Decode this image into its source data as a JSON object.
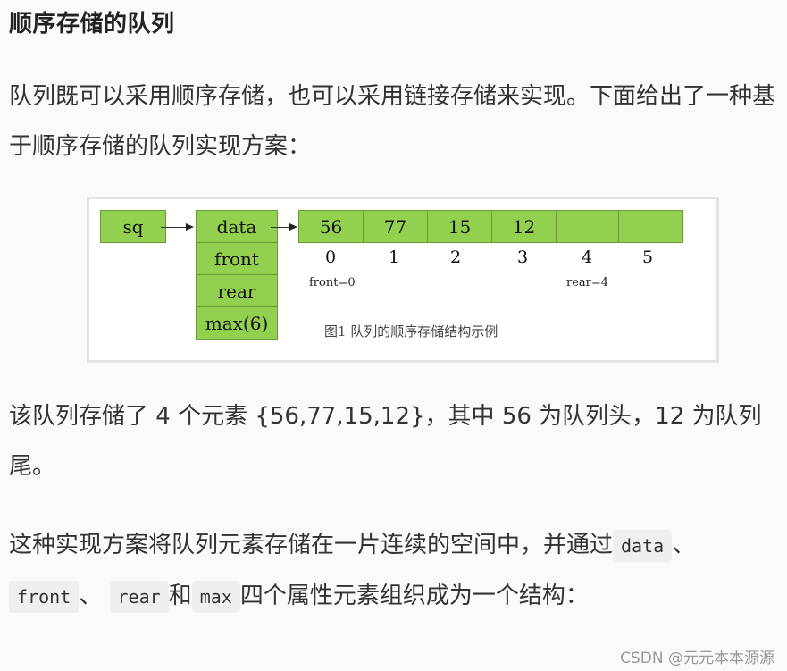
{
  "heading": "顺序存储的队列",
  "paragraph1": "队列既可以采用顺序存储，也可以采用链接存储来实现。下面给出了一种基于顺序存储的队列实现方案：",
  "figure": {
    "pointer_label": "sq",
    "struct_fields": [
      "data",
      "front",
      "rear",
      "max(6)"
    ],
    "array_values": [
      "56",
      "77",
      "15",
      "12",
      "",
      ""
    ],
    "indices": [
      "0",
      "1",
      "2",
      "3",
      "4",
      "5"
    ],
    "front_label": "front=0",
    "rear_label": "rear=4",
    "caption": "图1  队列的顺序存储结构示例",
    "box_color": "#92d050"
  },
  "paragraph2": "该队列存储了 4 个元素 {56,77,15,12}，其中 56 为队列头，12 为队列尾。",
  "paragraph3": {
    "part1": "这种实现方案将队列元素存储在一片连续的空间中，并通过",
    "code1": "data",
    "sep1": "、",
    "code2": "front",
    "sep2": "、",
    "code3": "rear",
    "and": "和",
    "code4": "max",
    "part2": "四个属性元素组织成为一个结构："
  },
  "watermark": "CSDN @元元本本源源"
}
